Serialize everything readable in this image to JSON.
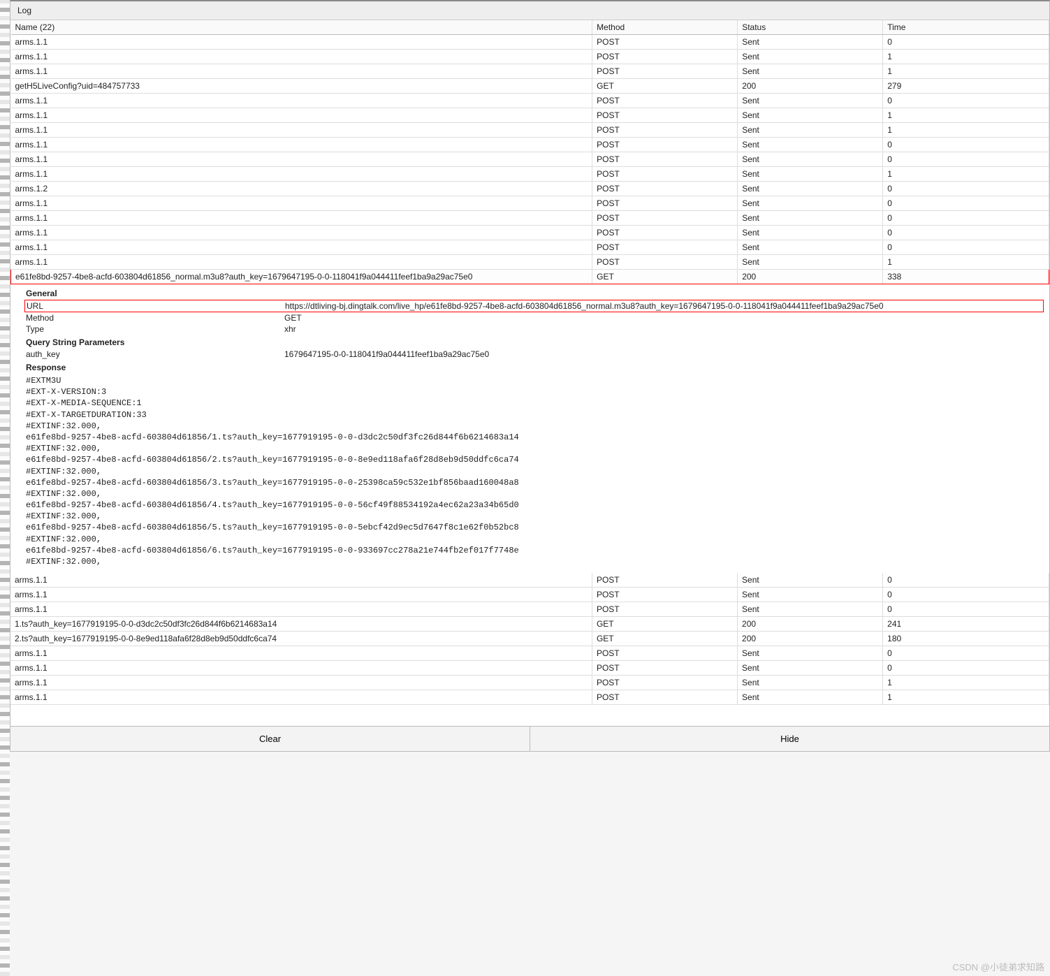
{
  "log_label": "Log",
  "columns": {
    "name": "Name (22)",
    "method": "Method",
    "status": "Status",
    "time": "Time"
  },
  "rows_top": [
    {
      "name": "arms.1.1",
      "method": "POST",
      "status": "Sent",
      "time": "0"
    },
    {
      "name": "arms.1.1",
      "method": "POST",
      "status": "Sent",
      "time": "1"
    },
    {
      "name": "arms.1.1",
      "method": "POST",
      "status": "Sent",
      "time": "1"
    },
    {
      "name": "getH5LiveConfig?uid=484757733",
      "method": "GET",
      "status": "200",
      "time": "279"
    },
    {
      "name": "arms.1.1",
      "method": "POST",
      "status": "Sent",
      "time": "0"
    },
    {
      "name": "arms.1.1",
      "method": "POST",
      "status": "Sent",
      "time": "1"
    },
    {
      "name": "arms.1.1",
      "method": "POST",
      "status": "Sent",
      "time": "1"
    },
    {
      "name": "arms.1.1",
      "method": "POST",
      "status": "Sent",
      "time": "0"
    },
    {
      "name": "arms.1.1",
      "method": "POST",
      "status": "Sent",
      "time": "0"
    },
    {
      "name": "arms.1.1",
      "method": "POST",
      "status": "Sent",
      "time": "1"
    },
    {
      "name": "arms.1.2",
      "method": "POST",
      "status": "Sent",
      "time": "0"
    },
    {
      "name": "arms.1.1",
      "method": "POST",
      "status": "Sent",
      "time": "0"
    },
    {
      "name": "arms.1.1",
      "method": "POST",
      "status": "Sent",
      "time": "0"
    },
    {
      "name": "arms.1.1",
      "method": "POST",
      "status": "Sent",
      "time": "0"
    },
    {
      "name": "arms.1.1",
      "method": "POST",
      "status": "Sent",
      "time": "0"
    },
    {
      "name": "arms.1.1",
      "method": "POST",
      "status": "Sent",
      "time": "1"
    }
  ],
  "highlight_row": {
    "name": "e61fe8bd-9257-4be8-acfd-603804d61856_normal.m3u8?auth_key=1679647195-0-0-118041f9a044411feef1ba9a29ac75e0",
    "method": "GET",
    "status": "200",
    "time": "338"
  },
  "detail": {
    "labels": {
      "general": "General",
      "url": "URL",
      "method": "Method",
      "type": "Type",
      "qsp": "Query String Parameters",
      "auth_key": "auth_key",
      "response": "Response"
    },
    "url": "https://dtliving-bj.dingtalk.com/live_hp/e61fe8bd-9257-4be8-acfd-603804d61856_normal.m3u8?auth_key=1679647195-0-0-118041f9a044411feef1ba9a29ac75e0",
    "method": "GET",
    "type": "xhr",
    "auth_key": "1679647195-0-0-118041f9a044411feef1ba9a29ac75e0",
    "response": "#EXTM3U\n#EXT-X-VERSION:3\n#EXT-X-MEDIA-SEQUENCE:1\n#EXT-X-TARGETDURATION:33\n#EXTINF:32.000,\ne61fe8bd-9257-4be8-acfd-603804d61856/1.ts?auth_key=1677919195-0-0-d3dc2c50df3fc26d844f6b6214683a14\n#EXTINF:32.000,\ne61fe8bd-9257-4be8-acfd-603804d61856/2.ts?auth_key=1677919195-0-0-8e9ed118afa6f28d8eb9d50ddfc6ca74\n#EXTINF:32.000,\ne61fe8bd-9257-4be8-acfd-603804d61856/3.ts?auth_key=1677919195-0-0-25398ca59c532e1bf856baad160048a8\n#EXTINF:32.000,\ne61fe8bd-9257-4be8-acfd-603804d61856/4.ts?auth_key=1677919195-0-0-56cf49f88534192a4ec62a23a34b65d0\n#EXTINF:32.000,\ne61fe8bd-9257-4be8-acfd-603804d61856/5.ts?auth_key=1677919195-0-0-5ebcf42d9ec5d7647f8c1e62f0b52bc8\n#EXTINF:32.000,\ne61fe8bd-9257-4be8-acfd-603804d61856/6.ts?auth_key=1677919195-0-0-933697cc278a21e744fb2ef017f7748e\n#EXTINF:32.000,"
  },
  "rows_bottom": [
    {
      "name": "arms.1.1",
      "method": "POST",
      "status": "Sent",
      "time": "0"
    },
    {
      "name": "arms.1.1",
      "method": "POST",
      "status": "Sent",
      "time": "0"
    },
    {
      "name": "arms.1.1",
      "method": "POST",
      "status": "Sent",
      "time": "0"
    },
    {
      "name": "1.ts?auth_key=1677919195-0-0-d3dc2c50df3fc26d844f6b6214683a14",
      "method": "GET",
      "status": "200",
      "time": "241"
    },
    {
      "name": "2.ts?auth_key=1677919195-0-0-8e9ed118afa6f28d8eb9d50ddfc6ca74",
      "method": "GET",
      "status": "200",
      "time": "180"
    },
    {
      "name": "arms.1.1",
      "method": "POST",
      "status": "Sent",
      "time": "0"
    },
    {
      "name": "arms.1.1",
      "method": "POST",
      "status": "Sent",
      "time": "0"
    },
    {
      "name": "arms.1.1",
      "method": "POST",
      "status": "Sent",
      "time": "1"
    },
    {
      "name": "arms.1.1",
      "method": "POST",
      "status": "Sent",
      "time": "1"
    }
  ],
  "buttons": {
    "clear": "Clear",
    "hide": "Hide"
  },
  "watermark": "CSDN @小徒弟求知路"
}
